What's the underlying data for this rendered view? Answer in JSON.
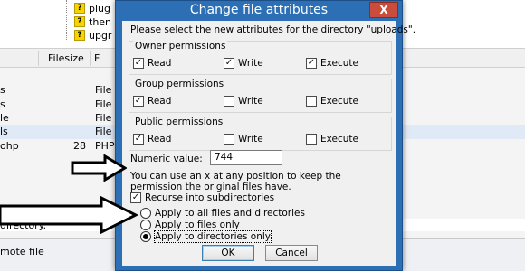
{
  "background": {
    "tree": [
      {
        "label": "plug"
      },
      {
        "label": "then"
      },
      {
        "label": "upgr"
      }
    ],
    "list_header": {
      "filesize": "Filesize",
      "filetype": "F"
    },
    "rows": [
      {
        "name": "s",
        "size": "",
        "type": "File"
      },
      {
        "name": "s",
        "size": "",
        "type": "File"
      },
      {
        "name": "le",
        "size": "",
        "type": "File"
      },
      {
        "name": "ls",
        "size": "",
        "type": "File"
      },
      {
        "name": "ohp",
        "size": "28",
        "type": "PHP"
      }
    ],
    "status_text": "directory.",
    "bottom_text": "mote file"
  },
  "dialog": {
    "title": "Change file attributes",
    "close_glyph": "X",
    "intro": "Please select the new attributes for the directory \"uploads\".",
    "groups": [
      {
        "label": "Owner permissions",
        "read": "Read",
        "write": "Write",
        "execute": "Execute",
        "read_checked": true,
        "write_checked": true,
        "execute_checked": true
      },
      {
        "label": "Group permissions",
        "read": "Read",
        "write": "Write",
        "execute": "Execute",
        "read_checked": true,
        "write_checked": false,
        "execute_checked": false
      },
      {
        "label": "Public permissions",
        "read": "Read",
        "write": "Write",
        "execute": "Execute",
        "read_checked": true,
        "write_checked": false,
        "execute_checked": false
      }
    ],
    "numeric_label": "Numeric value:",
    "numeric_value": "744",
    "hint": "You can use an x at any position to keep the permission the original files have.",
    "recurse_label": "Recurse into subdirectories",
    "recurse_checked": true,
    "radio_options": [
      {
        "label": "Apply to all files and directories",
        "selected": false
      },
      {
        "label": "Apply to files only",
        "selected": false
      },
      {
        "label": "Apply to directories only",
        "selected": true
      }
    ],
    "ok_label": "OK",
    "cancel_label": "Cancel"
  },
  "colors": {
    "title_bar": "#2c6fb5",
    "close": "#c94c3d",
    "selected_row": "#e0e9f6"
  }
}
